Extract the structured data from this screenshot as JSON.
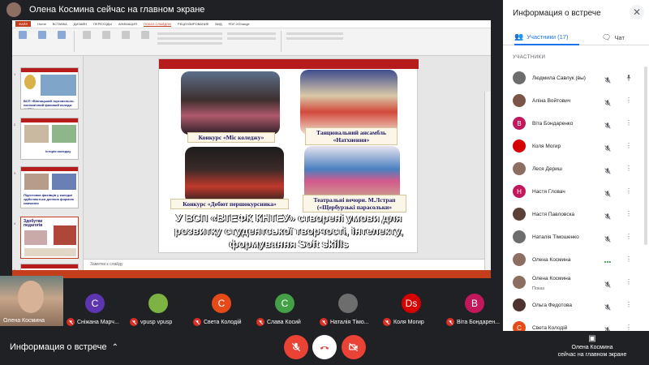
{
  "header": {
    "presenting_text": "Олена Космина сейчас на главном экране"
  },
  "ppt": {
    "tabs": [
      "ФАЙЛ",
      "Home",
      "ВСТАВКА",
      "ДИЗАЙН",
      "ПЕРЕХОДЫ",
      "АНИМАЦИЯ",
      "ПОКАЗ СЛАЙДОВ",
      "РЕЦЕНЗИРОВАНИЕ",
      "ВИД",
      "PDF-XChange"
    ],
    "notes_placeholder": "Заметки к слайду",
    "thumb_texts": [
      "ВСП «Вінницький торговельно-економічний фаховий коледж КНТЕУ»",
      "Історія коледжу",
      "Підготовка фахівців у коледжі здійснюється денною формою навчання",
      "Здобутки педагогів"
    ],
    "thumb_numbers": [
      "1",
      "2",
      "3",
      "4",
      "5"
    ]
  },
  "slide": {
    "captions": [
      "Конкурс «Міс коледжу»",
      "Танцювальний ансамбль «Натхнення»",
      "Конкурс «Дебют першокурсника»",
      "Театральні вечори. М.Лстрап («Щербурзькі парасольки»"
    ],
    "title": "У ВСП «ВТЕФК КНТЕУ» створені умови для розвитку студентської творчості, інтелекту, формування Soft skills"
  },
  "strip": {
    "self_name": "Олена Космина",
    "tiles": [
      {
        "initial": "C",
        "name": "Сніжана Марч...",
        "color": "#5e35b1"
      },
      {
        "initial": "",
        "name": "vpusp vpusp",
        "color": "#7cb342",
        "is_image": true
      },
      {
        "initial": "C",
        "name": "Света Колодій",
        "color": "#e64a19"
      },
      {
        "initial": "C",
        "name": "Слава Косий",
        "color": "#43a047"
      },
      {
        "initial": "",
        "name": "Наталія Тімо...",
        "color": "#6d6d6d",
        "is_image": true
      },
      {
        "initial": "Ds",
        "name": "Коля Могир",
        "color": "#d50000"
      },
      {
        "initial": "B",
        "name": "Віта Бондарен...",
        "color": "#c2185b"
      }
    ]
  },
  "bottom": {
    "meeting_info": "Информация о встрече",
    "present_line1": "Олена Космина",
    "present_line2": "сейчас на главном экране"
  },
  "panel": {
    "title": "Информация о встрече",
    "tab_people": "Участники (17)",
    "tab_chat": "Чат",
    "section_label": "УЧАСТНИКИ",
    "participants": [
      {
        "name": "Людмила Савлук (вы)",
        "initial": "",
        "color": "#6d6d6d",
        "mic": "muted",
        "extra": "pin"
      },
      {
        "name": "Аліна Войтович",
        "initial": "",
        "color": "#795548",
        "mic": "muted",
        "extra": "more"
      },
      {
        "name": "Віта Бондаренко",
        "initial": "B",
        "color": "#c2185b",
        "mic": "muted",
        "extra": "more"
      },
      {
        "name": "Коля Могир",
        "initial": "",
        "color": "#d50000",
        "mic": "muted",
        "extra": "more"
      },
      {
        "name": "Леся Дериш",
        "initial": "",
        "color": "#8d6e63",
        "mic": "muted",
        "extra": "more"
      },
      {
        "name": "Настя Гловач",
        "initial": "H",
        "color": "#c2185b",
        "mic": "muted",
        "extra": "more"
      },
      {
        "name": "Настя Павловска",
        "initial": "",
        "color": "#5d4037",
        "mic": "muted",
        "extra": "more"
      },
      {
        "name": "Наталія Тімошенко",
        "initial": "",
        "color": "#6d6d6d",
        "mic": "muted",
        "extra": "more"
      },
      {
        "name": "Олена Космина",
        "initial": "",
        "color": "#8d6e63",
        "mic": "active",
        "extra": "more"
      },
      {
        "name": "Олена Космина",
        "subtitle": "Показ",
        "initial": "",
        "color": "#8d6e63",
        "mic": "muted",
        "extra": "more"
      },
      {
        "name": "Ольга Федотова",
        "initial": "",
        "color": "#4e342e",
        "mic": "muted",
        "extra": "more"
      },
      {
        "name": "Света Колодій",
        "initial": "C",
        "color": "#e64a19",
        "mic": "muted",
        "extra": "more"
      }
    ]
  }
}
